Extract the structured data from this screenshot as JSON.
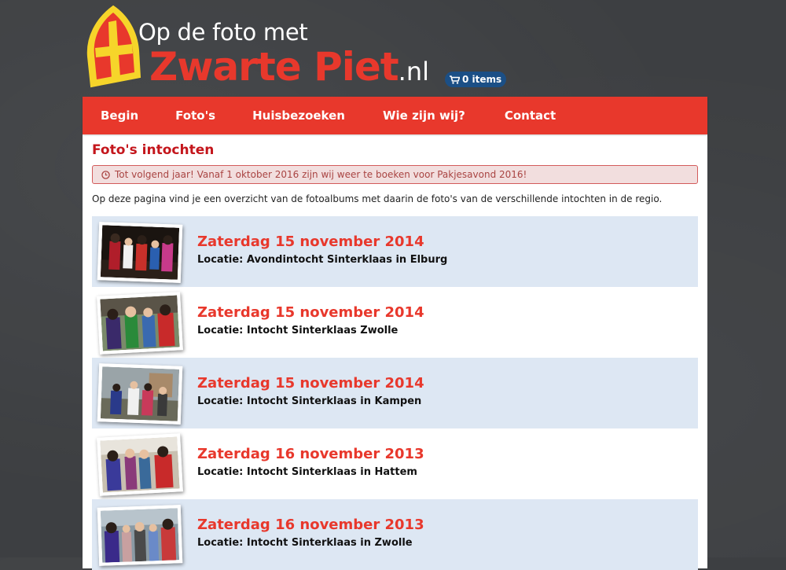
{
  "logo": {
    "line1": "Op de foto met",
    "main": "Zwarte Piet",
    "tld": ".nl"
  },
  "cart": {
    "label": "0 items"
  },
  "nav": [
    {
      "label": "Begin"
    },
    {
      "label": "Foto's"
    },
    {
      "label": "Huisbezoeken"
    },
    {
      "label": "Wie zijn wij?"
    },
    {
      "label": "Contact"
    }
  ],
  "page": {
    "title": "Foto's intochten",
    "alert": "Tot volgend jaar! Vanaf 1 oktober 2016 zijn wij weer te boeken voor Pakjesavond 2016!",
    "intro": "Op deze pagina vind je een overzicht van de fotoalbums met daarin de foto's van de verschillende intochten in de regio."
  },
  "albums": [
    {
      "date": "Zaterdag 15 november 2014",
      "location": "Locatie: Avondintocht Sinterklaas in Elburg"
    },
    {
      "date": "Zaterdag 15 november 2014",
      "location": "Locatie: Intocht Sinterklaas Zwolle"
    },
    {
      "date": "Zaterdag 15 november 2014",
      "location": "Locatie: Intocht Sinterklaas in Kampen"
    },
    {
      "date": "Zaterdag 16 november 2013",
      "location": "Locatie: Intocht Sinterklaas in Hattem"
    },
    {
      "date": "Zaterdag 16 november 2013",
      "location": "Locatie: Intocht Sinterklaas in Zwolle"
    }
  ],
  "colors": {
    "brand_red": "#e8382c",
    "title_red": "#c4161c",
    "alt_row": "#dde7f3",
    "alert_bg": "#f2dede",
    "cart_blue": "#1b4f86"
  }
}
